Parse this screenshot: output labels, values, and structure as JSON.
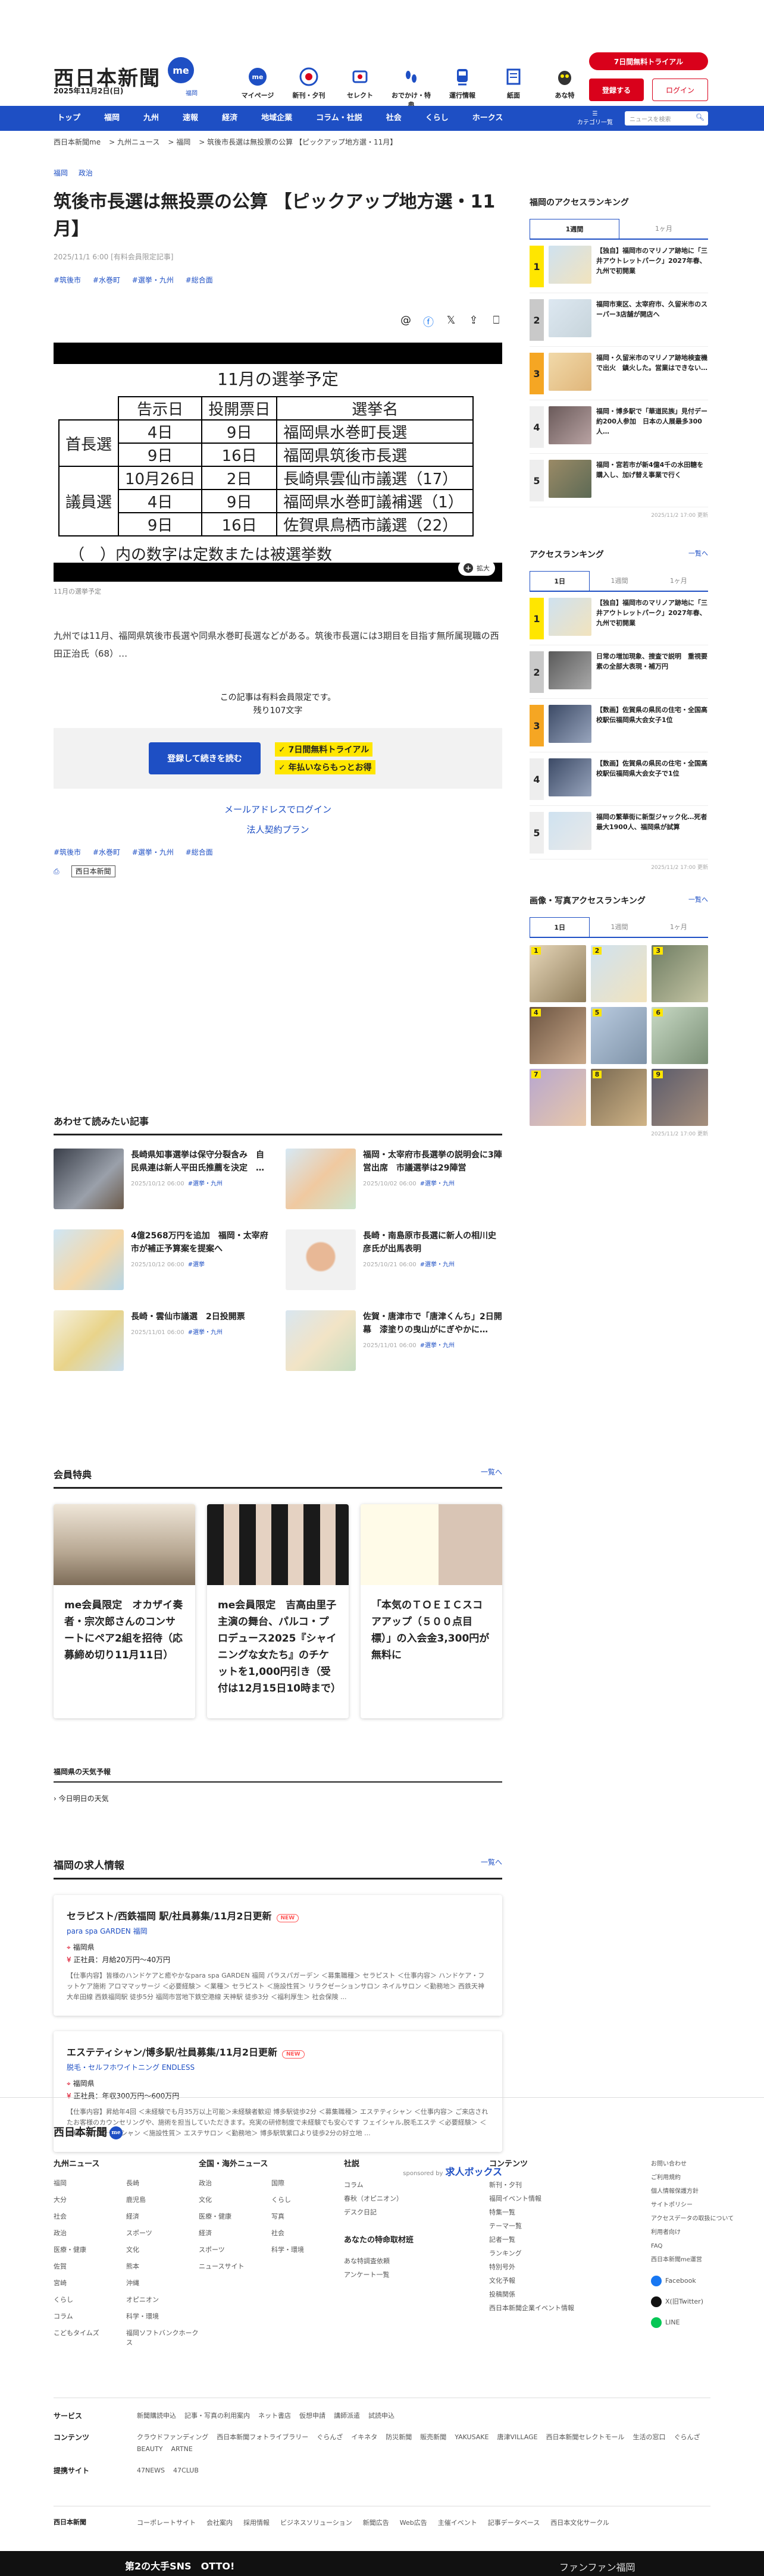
{
  "header": {
    "logo": "西日本新聞",
    "logo_badge": "me",
    "logo_sub": "福岡",
    "date": "2025年11月2日(日)",
    "nav": [
      {
        "label": "マイページ",
        "icon": "me-icon"
      },
      {
        "label": "新刊・夕刊",
        "icon": "newspaper-icon"
      },
      {
        "label": "セレクト",
        "icon": "select-icon"
      },
      {
        "label": "おでかけ・特典",
        "icon": "footprints-icon"
      },
      {
        "label": "運行情報",
        "icon": "train-icon"
      },
      {
        "label": "紙面",
        "icon": "paper-icon"
      },
      {
        "label": "あな特",
        "icon": "owl-icon"
      }
    ],
    "trial": "7日間無料トライアル",
    "register": "登録する",
    "login": "ログイン"
  },
  "gnav": {
    "items": [
      "トップ",
      "福岡",
      "九州",
      "速報",
      "経済",
      "地域企業",
      "コラム・社説",
      "社会",
      "くらし",
      "ホークス"
    ],
    "category": "カテゴリ一覧",
    "search_placeholder": "ニュースを検索"
  },
  "breadcrumb": [
    "西日本新聞me",
    "九州ニュース",
    "福岡",
    "筑後市長選は無投票の公算 【ピックアップ地方選・11月】"
  ],
  "article": {
    "categories": [
      "福岡",
      "政治"
    ],
    "title": "筑後市長選は無投票の公算 【ピックアップ地方選・11月】",
    "pubdate": "2025/11/1 6:00 [有料会員限定記事]",
    "tags": [
      "#筑後市",
      "#水巻町",
      "#選挙・九州",
      "#総合面"
    ],
    "share_icons": [
      "threads-icon",
      "facebook-icon",
      "x-icon",
      "share-icon",
      "bookmark-icon"
    ],
    "figure": {
      "title": "11月の選挙予定",
      "headers": [
        "告示日",
        "投開票日",
        "選挙名"
      ],
      "groups": [
        {
          "type": "首長選",
          "rows": [
            [
              "4日",
              "9日",
              "福岡県水巻町長選"
            ],
            [
              "9日",
              "16日",
              "福岡県筑後市長選"
            ]
          ]
        },
        {
          "type": "議員選",
          "rows": [
            [
              "10月26日",
              "2日",
              "長崎県雲仙市議選（17）"
            ],
            [
              "4日",
              "9日",
              "福岡県水巻町議補選（1）"
            ],
            [
              "9日",
              "16日",
              "佐賀県鳥栖市議選（22）"
            ]
          ]
        }
      ],
      "note": "（　）内の数字は定数または被選挙数",
      "zoom": "拡大"
    },
    "caption": "11月の選挙予定",
    "lead": "九州では11月、福岡県筑後市長選や同県水巻町長選などがある。筑後市長選には3期目を目指す無所属現職の西田正治氏（68）…",
    "premium_line1": "この記事は有料会員限定です。",
    "premium_line2": "残り107文字",
    "pay_button": "登録して続きを読む",
    "pay_points": [
      "7日間無料トライアル",
      "年払いならもっとお得"
    ],
    "mail_login": "メールアドレスでログイン",
    "terms": "法人契約プラン",
    "source_label": "西日本新聞"
  },
  "related": {
    "heading": "あわせて読みたい記事",
    "items": [
      {
        "title": "長崎県知事選挙は保守分裂含み　自民県連は新人平田氏推薦を決定　…",
        "date": "2025/10/12 06:00",
        "tag": "#選挙・九州"
      },
      {
        "title": "福岡・太宰府市長選挙の説明会に3陣営出席　市議選挙は29陣営",
        "date": "2025/10/02 06:00",
        "tag": "#選挙・九州"
      },
      {
        "title": "4億2568万円を追加　福岡・太宰府市が補正予算案を提案へ",
        "date": "2025/10/12 06:00",
        "tag": "#選挙"
      },
      {
        "title": "長崎・南島原市長選に新人の相川史彦氏が出馬表明",
        "date": "2025/10/21 06:00",
        "tag": "#選挙・九州"
      },
      {
        "title": "長崎・雲仙市議選　2日投開票",
        "date": "2025/11/01 06:00",
        "tag": "#選挙・九州"
      },
      {
        "title": "佐賀・唐津市で「唐津くんち」2日開幕　漆塗りの曳山がにぎやかに…",
        "date": "2025/11/01 06:00",
        "tag": "#選挙・九州"
      }
    ]
  },
  "member": {
    "heading": "会員特典",
    "more": "一覧へ",
    "cards": [
      {
        "title": "me会員限定　オカザイ奏者・宗次郎さんのコンサートにペア2組を招待（応募締め切り11月11日）"
      },
      {
        "title": "me会員限定　吉高由里子主演の舞台、パルコ・プロデュース2025『シャイニングな女たち』のチケットを1,000円引き（受付は12月15日10時まで）"
      },
      {
        "title": "「本気のＴＯＥＩＣスコアアップ（５００点目標）」の入会金3,300円が無料に"
      }
    ]
  },
  "weather": {
    "heading": "福岡県の天気予報",
    "today": "今日明日の天気"
  },
  "jobs": {
    "heading": "福岡の求人情報",
    "more": "一覧へ",
    "items": [
      {
        "title": "セラピスト/西鉄福岡 駅/社員募集/11月2日更新",
        "new": "NEW",
        "company": "para spa GARDEN 福岡",
        "area": "福岡県",
        "salary": "正社員：月給20万円〜40万円",
        "desc": "【仕事内容】皆様のハンドケアと癒やかなpara spa GARDEN 福岡 パラスパガーデン ＜募集職種＞ セラピスト ＜仕事内容＞ ハンドケア・フットケア施術 アロママッサージ ＜必要経験＞ ＜業種＞ セラピスト ＜施設性質＞ リラクゼーションサロン ネイルサロン ＜勤務地＞ 西鉄天神大牟田線 西鉄福岡駅 徒歩5分 福岡市営地下鉄空港線 天神駅 徒歩3分 ＜福利厚生＞ 社会保険 ..."
      },
      {
        "title": "エステティシャン/博多駅/社員募集/11月2日更新",
        "new": "NEW",
        "company": "脱毛・セルフホワイトニング ENDLESS",
        "area": "福岡県",
        "salary": "正社員：年収300万円〜600万円",
        "desc": "【仕事内容】昇給年4回 ＜未経験でも月35万以上可能＞未経験者歓迎 博多駅徒歩2分 ＜募集職種＞ エステティシャン ＜仕事内容＞ ご来店されたお客様のカウンセリングや、施術を担当していただきます。充実の研修制度で未経験でも安心です フェイシャル,脱毛エステ ＜必要経験＞ ＜業種＞ エステティシャン ＜施設性質＞ エステサロン ＜勤務地＞ 博多駅筑紫口より徒歩2分の好立地 ..."
      }
    ],
    "sponsor_label": "sponsored by",
    "sponsor_name": "求人ボックス"
  },
  "sidebar": {
    "access_fukuoka": {
      "heading": "福岡のアクセスランキング",
      "tabs": [
        "1週間",
        "1ヶ月"
      ],
      "items": [
        "【独自】福岡市のマリノア跡地に「三井アウトレットパーク」2027年春、九州で初開業",
        "福岡市東区、太宰府市、久留米市のスーパー3店舗が開店へ",
        "福岡・久留米市のマリノア跡地検査機で出火　鎮火した。営業はできない…",
        "福岡・博多駅で「華道民族」見付デー約200人参加　日本の人展最多300人…",
        "福岡・宮若市が新4億4千の水田糖を購入し、加げ替え事業で行く"
      ],
      "updated": "2025/11/2 17:00 更新"
    },
    "access": {
      "heading": "アクセスランキング",
      "more": "一覧へ",
      "tabs": [
        "1日",
        "1週間",
        "1ヶ月"
      ],
      "items": [
        "【独自】福岡市のマリノア跡地に「三井アウトレットパーク」2027年春、九州で初開業",
        "日常の増加現象、捜査で説明　重視要素の全部大表現・補万円",
        "【数画】佐賀県の県民の住宅・全国高校駅伝福岡県大会女子1位 ",
        "【数画】佐賀県の県民の住宅・全国高校駅伝福岡県大会女子で1位",
        "福岡の繁華街に新型ジャック化…死者最大1900人、福岡県が試算"
      ],
      "updated": "2025/11/2 17:00 更新"
    },
    "photo": {
      "heading": "画像・写真アクセスランキング",
      "more": "一覧へ",
      "tabs": [
        "1日",
        "1週間",
        "1ヶ月"
      ],
      "items": [
        "1",
        "2",
        "3",
        "4",
        "5",
        "6",
        "7",
        "8",
        "9"
      ],
      "updated": "2025/11/2 17:00 更新"
    }
  },
  "footer": {
    "logo": "西日本新聞",
    "logo_badge": "me",
    "cols": [
      {
        "heading": "九州ニュース",
        "links": [
          "福岡",
          "長崎",
          "大分",
          "鹿児島",
          "社会",
          "経済",
          "政治",
          "スポーツ",
          "医療・健康",
          "文化",
          "佐賀",
          "熊本",
          "宮崎",
          "沖縄",
          "くらし",
          "オピニオン",
          "コラム",
          "科学・環境",
          "こどもタイムズ",
          "福岡ソフトバンクホークス"
        ]
      },
      {
        "heading": "全国・海外ニュース",
        "links": [
          "政治",
          "国際",
          "文化",
          "くらし",
          "医療・健康",
          "写真",
          "経済",
          "社会",
          "スポーツ",
          "科学・環境",
          "ニュースサイト"
        ]
      },
      {
        "heading": "社説",
        "links": [
          "コラム",
          "春秋（オピニオン）",
          "デスク日記"
        ]
      },
      {
        "heading": "コンテンツ",
        "links": [
          "新刊・夕刊",
          "福岡イベント情報",
          "特集一覧",
          "テーマ一覧",
          "記者一覧",
          "ランキング",
          "特別号外",
          "文化予報",
          "投稿関係",
          "西日本新聞企業イベント情報"
        ]
      }
    ],
    "special_heading": "あなたの特命取材班",
    "special_links": [
      "あな特調査依頼",
      "アンケート一覧"
    ],
    "side_links": [
      "お問い合わせ",
      "ご利用規約",
      "個人情報保護方針",
      "サイトポリシー",
      "アクセスデータの取扱について",
      "利用者向け",
      "FAQ",
      "西日本新聞me運営"
    ],
    "social": [
      {
        "label": "Facebook",
        "color": "#1877f2"
      },
      {
        "label": "X(旧Twitter)",
        "color": "#111111"
      },
      {
        "label": "LINE",
        "color": "#06c755"
      }
    ],
    "rows": [
      {
        "label": "サービス",
        "links": [
          "新聞購読申込",
          "記事・写真の利用案内",
          "ネット書店",
          "仮想申請",
          "講師派遣",
          "試読申込"
        ]
      },
      {
        "label": "コンテンツ",
        "links": [
          "クラウドファンディング",
          "西日本新聞フォトライブラリー",
          "ぐらんざ",
          "イキネタ",
          "防災新聞",
          "販売新聞",
          "YAKUSAKE",
          "唐津VILLAGE",
          "西日本新聞セレクトモール",
          "生活の窓口",
          "ぐらんざBEAUTY",
          "ARTNE"
        ]
      },
      {
        "label": "提携サイト",
        "links": [
          "47NEWS",
          "47CLUB"
        ]
      }
    ],
    "corp_label": "西日本新聞",
    "corp_links": [
      "コーポレートサイト",
      "会社案内",
      "採用情報",
      "ビジネスソリューション",
      "新聞広告",
      "Web広告",
      "主催イベント",
      "記事データベース",
      "西日本文化サークル"
    ],
    "bar_left": "第2の大手SNS　OTTO!",
    "bar_right": "ファンファン福岡"
  },
  "colors": {
    "brand": "#1e4fc4",
    "accent": "#d9011b",
    "highlight": "#ffe600"
  }
}
